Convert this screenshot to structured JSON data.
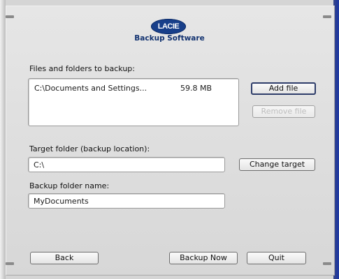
{
  "logo": {
    "text": "LACIE",
    "subtitle": "Backup Software"
  },
  "files": {
    "label": "Files and folders to backup:",
    "items": [
      {
        "path": "C:\\Documents and Settings...",
        "size": "59.8 MB"
      }
    ],
    "add_label": "Add file",
    "remove_label": "Remove file"
  },
  "target": {
    "label": "Target folder (backup location):",
    "value": "C:\\",
    "change_label": "Change target"
  },
  "backup_name": {
    "label": "Backup folder name:",
    "value": "MyDocuments"
  },
  "footer": {
    "back_label": "Back",
    "backup_now_label": "Backup Now",
    "quit_label": "Quit"
  },
  "colors": {
    "accent": "#183f8a",
    "window_blue": "#243a98"
  }
}
